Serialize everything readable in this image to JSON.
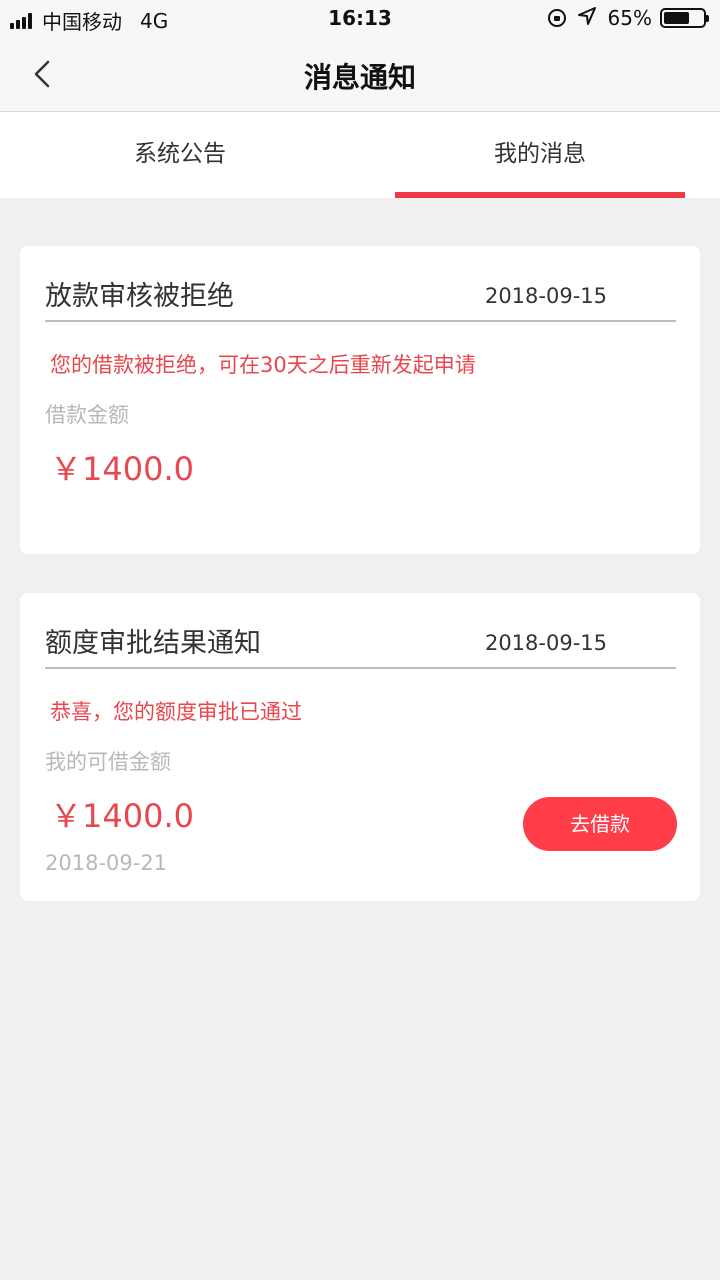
{
  "status_bar": {
    "carrier": "中国移动",
    "network": "4G",
    "time": "16:13",
    "battery_text": "65%",
    "battery_level": 0.65
  },
  "nav": {
    "title": "消息通知",
    "back_icon": "chevron-left-icon"
  },
  "tabs": [
    {
      "label": "系统公告",
      "active": false
    },
    {
      "label": "我的消息",
      "active": true
    }
  ],
  "messages": [
    {
      "title": "放款审核被拒绝",
      "date": "2018-09-15",
      "message": "您的借款被拒绝，可在30天之后重新发起申请",
      "amount_label": "借款金额",
      "amount": "￥1400.0"
    },
    {
      "title": "额度审批结果通知",
      "date": "2018-09-15",
      "message": "恭喜，您的额度审批已通过",
      "amount_label": "我的可借金额",
      "amount": "￥1400.0",
      "sub_date": "2018-09-21",
      "action_label": "去借款"
    }
  ],
  "colors": {
    "accent": "#f03a46",
    "button": "#fe3d49",
    "message_text": "#e8474d",
    "muted_text": "#b8b8b8"
  }
}
